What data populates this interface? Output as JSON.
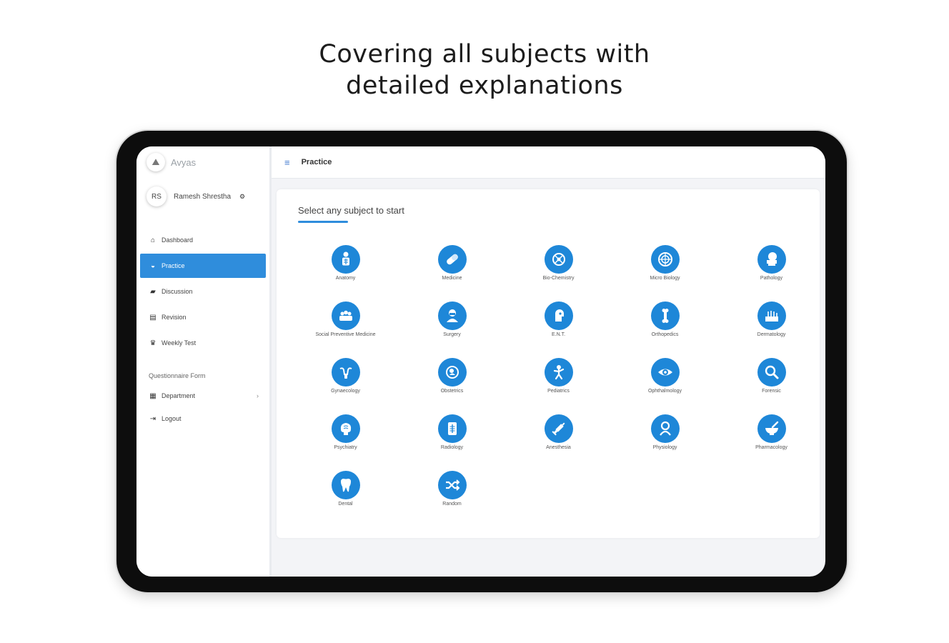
{
  "headline": {
    "line1": "Covering all subjects with",
    "line2": "detailed explanations"
  },
  "app": {
    "name": "Avyas",
    "logo_glyph": "⛰"
  },
  "user": {
    "initials": "RS",
    "name": "Ramesh Shrestha"
  },
  "sidebar": {
    "items": [
      {
        "label": "Dashboard",
        "icon": "home-icon"
      },
      {
        "label": "Practice",
        "icon": "practice-icon",
        "active": true
      },
      {
        "label": "Discussion",
        "icon": "discussion-icon"
      },
      {
        "label": "Revision",
        "icon": "revision-icon"
      },
      {
        "label": "Weekly Test",
        "icon": "trophy-icon"
      }
    ],
    "section_label": "Questionnaire Form",
    "section_items": [
      {
        "label": "Department",
        "icon": "department-icon",
        "has_chevron": true
      },
      {
        "label": "Logout",
        "icon": "logout-icon"
      }
    ]
  },
  "topbar": {
    "title": "Practice"
  },
  "main": {
    "heading": "Select any subject to start",
    "subjects": [
      {
        "label": "Anatomy",
        "icon": "anatomy-icon"
      },
      {
        "label": "Medicine",
        "icon": "pill-icon"
      },
      {
        "label": "Bio-Chemistry",
        "icon": "molecule-icon"
      },
      {
        "label": "Micro Biology",
        "icon": "microbe-icon"
      },
      {
        "label": "Pathology",
        "icon": "microscope-icon"
      },
      {
        "label": "Social Preventive Medicine",
        "icon": "community-icon"
      },
      {
        "label": "Surgery",
        "icon": "surgeon-icon"
      },
      {
        "label": "E.N.T.",
        "icon": "ent-icon"
      },
      {
        "label": "Orthopedics",
        "icon": "bone-icon"
      },
      {
        "label": "Dermatology",
        "icon": "skin-icon"
      },
      {
        "label": "Gynaecology",
        "icon": "uterus-icon"
      },
      {
        "label": "Obstetrics",
        "icon": "pregnancy-icon"
      },
      {
        "label": "Pediatrics",
        "icon": "child-icon"
      },
      {
        "label": "Ophthalmology",
        "icon": "eye-icon"
      },
      {
        "label": "Forensic",
        "icon": "magnifier-icon"
      },
      {
        "label": "Psychiatry",
        "icon": "brain-icon"
      },
      {
        "label": "Radiology",
        "icon": "xray-icon"
      },
      {
        "label": "Anesthesia",
        "icon": "syringe-icon"
      },
      {
        "label": "Physiology",
        "icon": "body-icon"
      },
      {
        "label": "Pharmacology",
        "icon": "mortar-icon"
      },
      {
        "label": "Dental",
        "icon": "tooth-icon"
      },
      {
        "label": "Random",
        "icon": "shuffle-icon"
      }
    ]
  },
  "colors": {
    "accent": "#2f8ddc",
    "icon_bg": "#1e87d8"
  }
}
